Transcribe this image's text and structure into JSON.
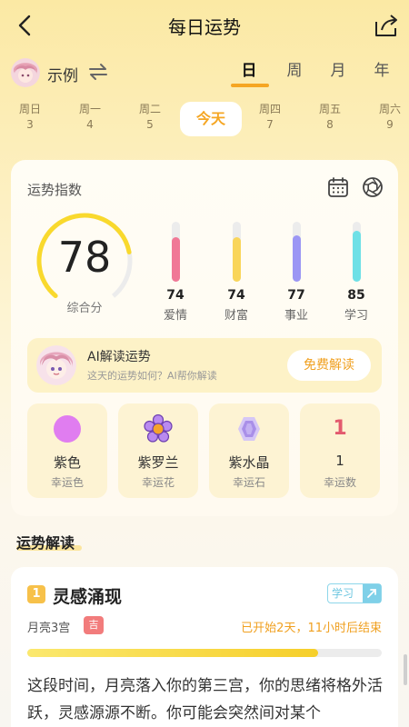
{
  "header": {
    "title": "每日运势",
    "back_icon": "chevron-left-icon",
    "share_icon": "share-icon"
  },
  "user": {
    "name": "示例",
    "switch_icon": "swap-icon"
  },
  "periods": [
    {
      "label": "日",
      "active": true
    },
    {
      "label": "周",
      "active": false
    },
    {
      "label": "月",
      "active": false
    },
    {
      "label": "年",
      "active": false
    }
  ],
  "days": [
    {
      "weekday": "周日",
      "date": "3"
    },
    {
      "weekday": "周一",
      "date": "4"
    },
    {
      "weekday": "周二",
      "date": "5"
    },
    {
      "weekday": "周四",
      "date": "7"
    },
    {
      "weekday": "周五",
      "date": "8"
    },
    {
      "weekday": "周六",
      "date": "9"
    }
  ],
  "today_label": "今天",
  "fortune": {
    "title": "运势指数",
    "calendar_icon": "calendar-icon",
    "settings_icon": "aperture-icon",
    "overall": {
      "score": "78",
      "label": "综合分",
      "fraction": 0.78
    },
    "categories": [
      {
        "value": "74",
        "label": "爱情",
        "color": "#f07896",
        "fraction": 0.74
      },
      {
        "value": "74",
        "label": "财富",
        "color": "#f9d55a",
        "fraction": 0.74
      },
      {
        "value": "77",
        "label": "事业",
        "color": "#9b96f4",
        "fraction": 0.77
      },
      {
        "value": "85",
        "label": "学习",
        "color": "#6ee0e6",
        "fraction": 0.85
      }
    ]
  },
  "ai": {
    "title": "AI解读运势",
    "subtitle": "这天的运势如何？AI帮你解读",
    "button": "免费解读"
  },
  "lucky": [
    {
      "value": "紫色",
      "label": "幸运色",
      "icon": "purple-dot-icon"
    },
    {
      "value": "紫罗兰",
      "label": "幸运花",
      "icon": "flower-icon"
    },
    {
      "value": "紫水晶",
      "label": "幸运石",
      "icon": "crystal-icon"
    },
    {
      "value": "1",
      "label": "幸运数",
      "icon": "number-icon"
    }
  ],
  "section": {
    "title": "运势解读"
  },
  "reading": {
    "index": "1",
    "title": "灵感涌现",
    "tag": "学习",
    "house": "月亮3宫",
    "auspicious": "吉",
    "duration": "已开始2天，11小时后结束",
    "progress": 0.82,
    "text": "这段时间，月亮落入你的第三宫，你的思绪将格外活跃，灵感源源不断。你可能会突然间对某个"
  },
  "colors": {
    "accent": "#f5a623",
    "gauge_yellow": "#f9d92d"
  }
}
